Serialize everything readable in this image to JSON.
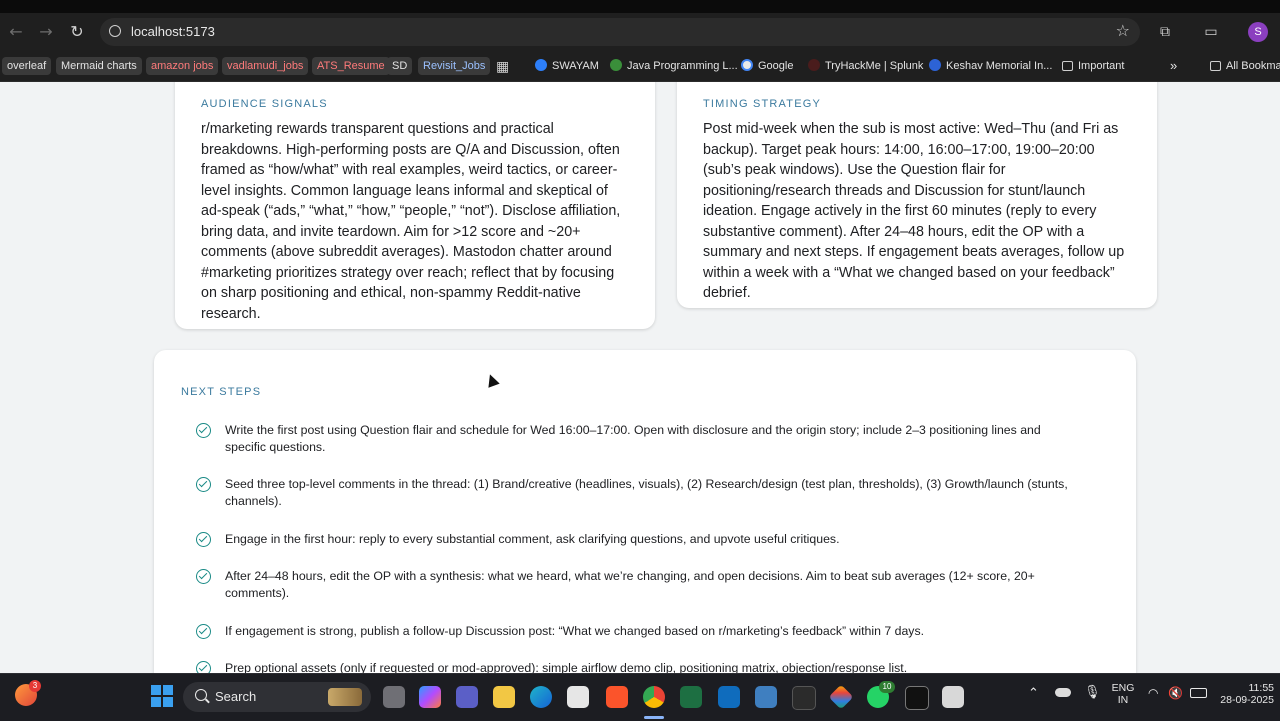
{
  "browser": {
    "url": "localhost:5173",
    "profile_initial": "S",
    "bookmarks": [
      {
        "label": "overleaf"
      },
      {
        "label": "Mermaid charts"
      },
      {
        "label": "amazon jobs"
      },
      {
        "label": "vadlamudi_jobs"
      },
      {
        "label": "ATS_Resume"
      },
      {
        "label": "SD"
      },
      {
        "label": "Revisit_Jobs"
      },
      {
        "label": "SWAYAM"
      },
      {
        "label": "Java Programming L..."
      },
      {
        "label": "Google"
      },
      {
        "label": "TryHackMe | Splunk"
      },
      {
        "label": "Keshav Memorial In..."
      },
      {
        "label": "Important"
      },
      {
        "label": "All Bookma"
      }
    ]
  },
  "audience": {
    "title": "AUDIENCE SIGNALS",
    "body": "r/marketing rewards transparent questions and practical breakdowns. High-performing posts are Q/A and Discussion, often framed as “how/what” with real examples, weird tactics, or career-level insights. Common language leans informal and skeptical of ad-speak (“ads,” “what,” “how,” “people,” “not”). Disclose affiliation, bring data, and invite teardown. Aim for >12 score and ~20+ comments (above subreddit averages). Mastodon chatter around #marketing prioritizes strategy over reach; reflect that by focusing on sharp positioning and ethical, non-spammy Reddit-native research."
  },
  "timing": {
    "title": "TIMING STRATEGY",
    "body": "Post mid-week when the sub is most active: Wed–Thu (and Fri as backup). Target peak hours: 14:00, 16:00–17:00, 19:00–20:00 (sub’s peak windows). Use the Question flair for positioning/research threads and Discussion for stunt/launch ideation. Engage actively in the first 60 minutes (reply to every substantive comment). After 24–48 hours, edit the OP with a summary and next steps. If engagement beats averages, follow up within a week with a “What we changed based on your feedback” debrief."
  },
  "next_steps": {
    "title": "NEXT STEPS",
    "items": [
      "Write the first post using Question flair and schedule for Wed 16:00–17:00. Open with disclosure and the origin story; include 2–3 positioning lines and specific questions.",
      "Seed three top-level comments in the thread: (1) Brand/creative (headlines, visuals), (2) Research/design (test plan, thresholds), (3) Growth/launch (stunts, channels).",
      "Engage in the first hour: reply to every substantial comment, ask clarifying questions, and upvote useful critiques.",
      "After 24–48 hours, edit the OP with a synthesis: what we heard, what we’re changing, and open decisions. Aim to beat sub averages (12+ score, 20+ comments).",
      "If engagement is strong, publish a follow-up Discussion post: “What we changed based on r/marketing’s feedback” within 7 days.",
      "Prep optional assets (only if requested or mod-approved): simple airflow demo clip, positioning matrix, objection/response list."
    ]
  },
  "taskbar": {
    "search_label": "Search",
    "notif_badge": "3",
    "whatsapp_badge": "10",
    "lang_line1": "ENG",
    "lang_line2": "IN",
    "time": "11:55",
    "date": "28-09-2025"
  }
}
